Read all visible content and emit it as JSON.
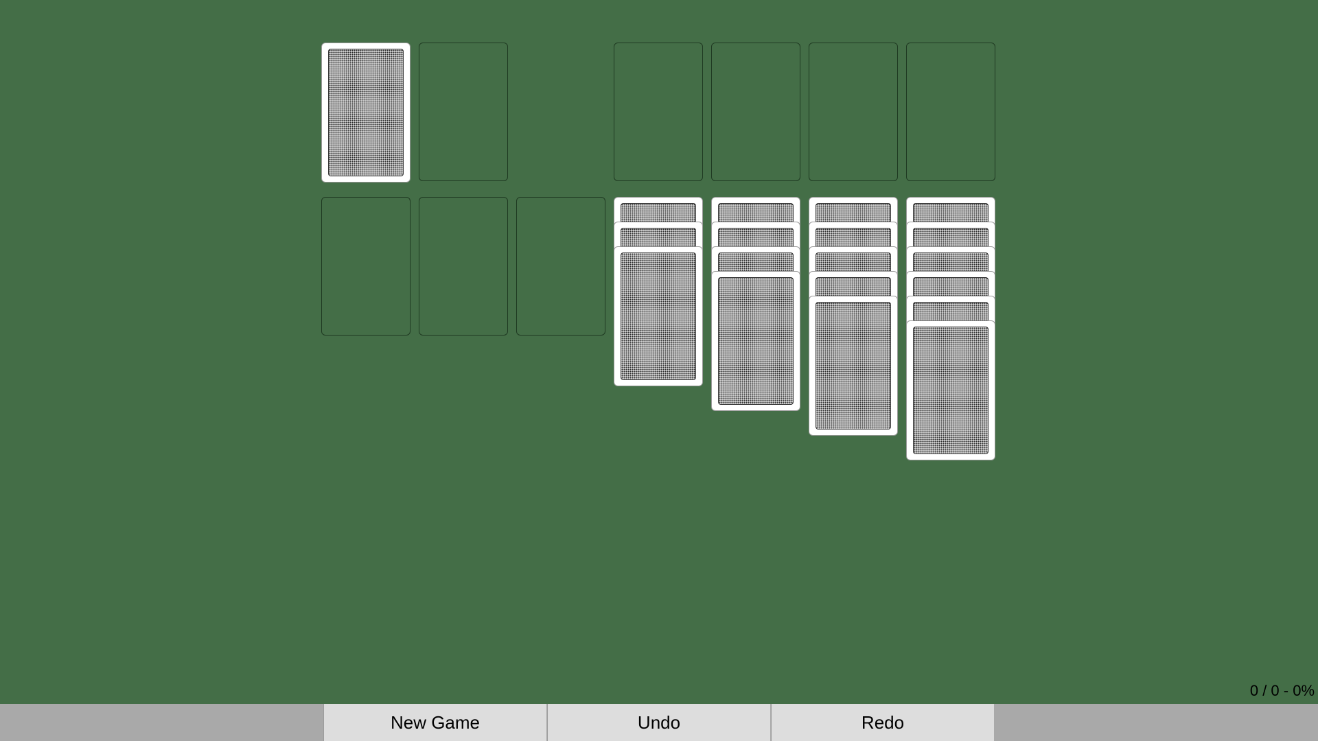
{
  "game": {
    "stock": {
      "face_down_cards": 1
    },
    "waste": {
      "cards": 0
    },
    "foundations": [
      {
        "cards": 0
      },
      {
        "cards": 0
      },
      {
        "cards": 0
      },
      {
        "cards": 0
      }
    ],
    "tableau": [
      {
        "face_down_cards": 0
      },
      {
        "face_down_cards": 0
      },
      {
        "face_down_cards": 0
      },
      {
        "face_down_cards": 3
      },
      {
        "face_down_cards": 4
      },
      {
        "face_down_cards": 5
      },
      {
        "face_down_cards": 6
      }
    ]
  },
  "status": {
    "score_text": "0 / 0 - 0%"
  },
  "toolbar": {
    "new_game_label": "New Game",
    "undo_label": "Undo",
    "redo_label": "Redo"
  },
  "colors": {
    "table_felt": "#446e47",
    "toolbar_bg": "#a9a9a9",
    "button_bg": "#dddddd",
    "card_face": "#ffffff"
  }
}
